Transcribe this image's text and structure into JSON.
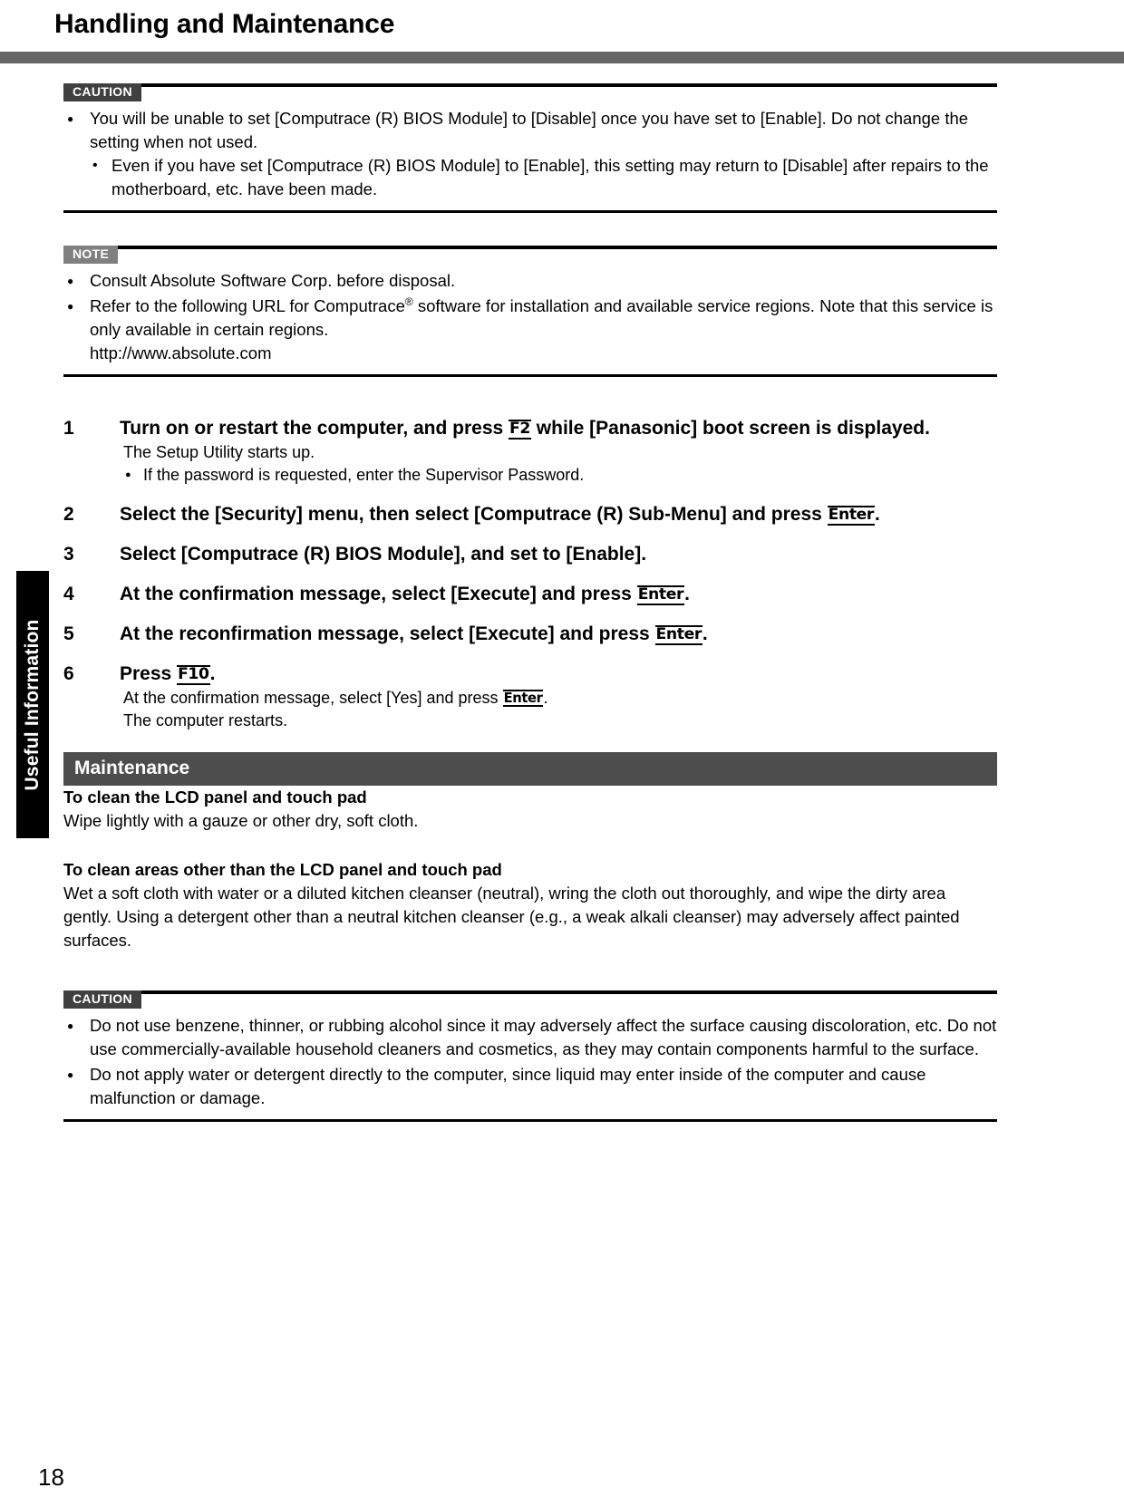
{
  "header": {
    "title": "Handling and Maintenance"
  },
  "caution_top": {
    "label": "CAUTION",
    "bullets": [
      "You will be unable to set [Computrace (R) BIOS Module] to [Disable] once you have set to [Enable]. Do not change the setting when not used."
    ],
    "subbullets": [
      "Even if you have set [Computrace (R) BIOS Module] to [Enable], this setting may return to [Disable] after repairs to the motherboard, etc. have been made."
    ]
  },
  "note": {
    "label": "NOTE",
    "bullet1": "Consult Absolute Software Corp. before disposal.",
    "bullet2_pre": "Refer to the following URL for Computrace",
    "bullet2_sup": "®",
    "bullet2_post": " software for installation and available service regions. Note that this service is only available in certain regions.",
    "url": "http://www.absolute.com"
  },
  "steps": [
    {
      "num": "1",
      "head_pre": "Turn on or restart the computer, and press ",
      "key": "F2",
      "head_post": " while [Panasonic] boot screen is displayed.",
      "sub": "The Setup Utility starts up.",
      "subbullet": "If the password is requested, enter the Supervisor Password."
    },
    {
      "num": "2",
      "head_pre": "Select the [Security] menu, then select [Computrace (R) Sub-Menu] and press ",
      "key": "Enter",
      "head_post": "."
    },
    {
      "num": "3",
      "head_pre": "Select [Computrace (R) BIOS Module], and set to [Enable].",
      "key": "",
      "head_post": ""
    },
    {
      "num": "4",
      "head_pre": "At the confirmation message, select [Execute] and press ",
      "key": "Enter",
      "head_post": "."
    },
    {
      "num": "5",
      "head_pre": "At the reconfirmation message, select [Execute] and press ",
      "key": "Enter",
      "head_post": "."
    },
    {
      "num": "6",
      "head_pre": "Press ",
      "key": "F10",
      "head_post": ".",
      "sub_pre": "At the confirmation message, select [Yes] and press ",
      "sub_key": "Enter",
      "sub_post": ".",
      "sub2": "The computer restarts."
    }
  ],
  "maintenance": {
    "bar_title": "Maintenance",
    "head1": "To clean the LCD panel and touch pad",
    "para1": "Wipe lightly with a gauze or other dry, soft cloth.",
    "head2": "To clean areas other than the LCD panel and touch pad",
    "para2": "Wet a soft cloth with water or a diluted kitchen cleanser (neutral), wring the cloth out thoroughly, and wipe the dirty area gently.  Using a detergent other than a neutral kitchen cleanser (e.g., a weak alkali cleanser) may adversely affect painted surfaces."
  },
  "caution_bottom": {
    "label": "CAUTION",
    "bullets": [
      "Do not use benzene, thinner, or rubbing alcohol since it may adversely affect the surface causing discoloration, etc. Do not use commercially-available household cleaners and cosmetics, as they may contain components harmful to the surface.",
      "Do not apply water or detergent directly to the computer, since liquid may enter inside of the computer and cause malfunction or damage."
    ]
  },
  "side_tab": {
    "label": "Useful Information"
  },
  "footer": {
    "page_number": "18"
  }
}
